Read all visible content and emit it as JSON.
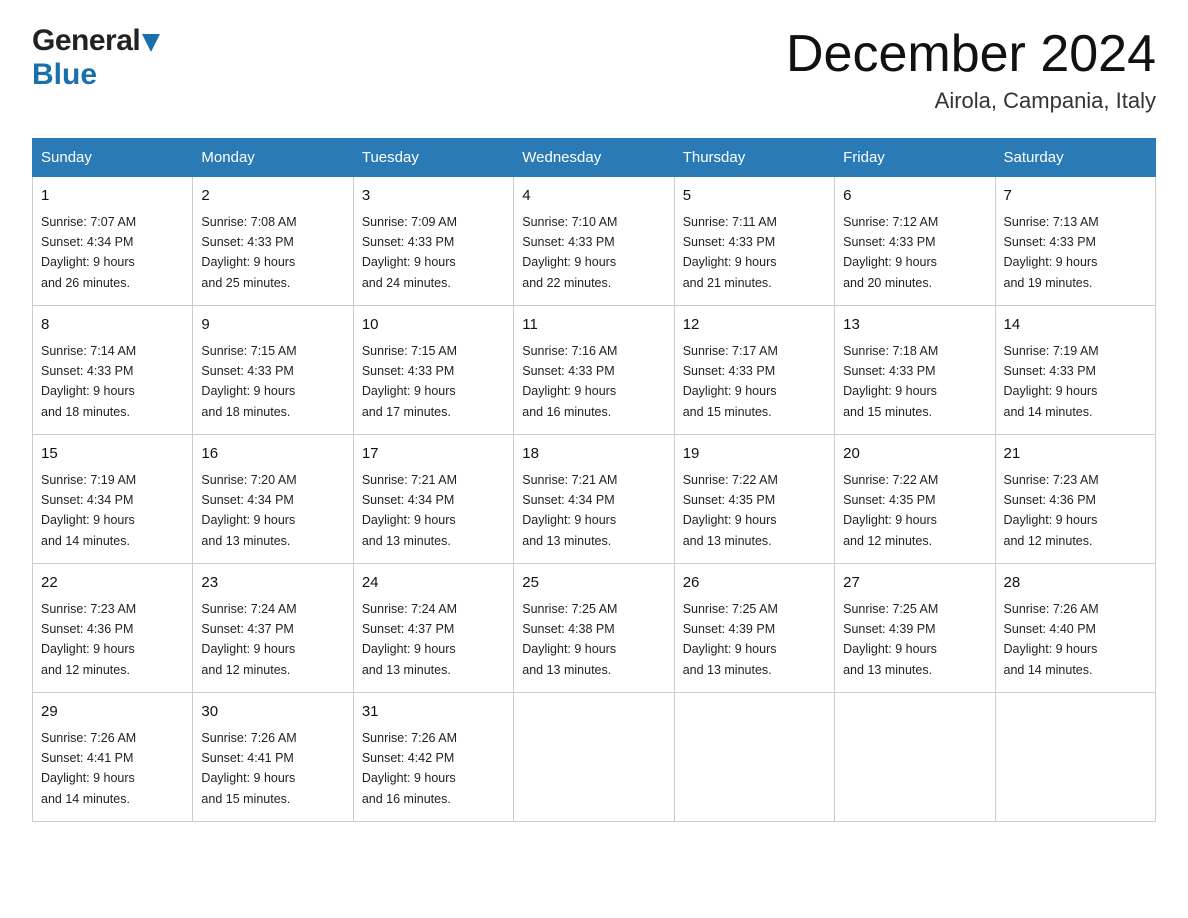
{
  "header": {
    "logo_general": "General",
    "logo_blue": "Blue",
    "month_year": "December 2024",
    "location": "Airola, Campania, Italy"
  },
  "days_of_week": [
    "Sunday",
    "Monday",
    "Tuesday",
    "Wednesday",
    "Thursday",
    "Friday",
    "Saturday"
  ],
  "weeks": [
    [
      {
        "day": "1",
        "sunrise": "7:07 AM",
        "sunset": "4:34 PM",
        "daylight": "9 hours and 26 minutes."
      },
      {
        "day": "2",
        "sunrise": "7:08 AM",
        "sunset": "4:33 PM",
        "daylight": "9 hours and 25 minutes."
      },
      {
        "day": "3",
        "sunrise": "7:09 AM",
        "sunset": "4:33 PM",
        "daylight": "9 hours and 24 minutes."
      },
      {
        "day": "4",
        "sunrise": "7:10 AM",
        "sunset": "4:33 PM",
        "daylight": "9 hours and 22 minutes."
      },
      {
        "day": "5",
        "sunrise": "7:11 AM",
        "sunset": "4:33 PM",
        "daylight": "9 hours and 21 minutes."
      },
      {
        "day": "6",
        "sunrise": "7:12 AM",
        "sunset": "4:33 PM",
        "daylight": "9 hours and 20 minutes."
      },
      {
        "day": "7",
        "sunrise": "7:13 AM",
        "sunset": "4:33 PM",
        "daylight": "9 hours and 19 minutes."
      }
    ],
    [
      {
        "day": "8",
        "sunrise": "7:14 AM",
        "sunset": "4:33 PM",
        "daylight": "9 hours and 18 minutes."
      },
      {
        "day": "9",
        "sunrise": "7:15 AM",
        "sunset": "4:33 PM",
        "daylight": "9 hours and 18 minutes."
      },
      {
        "day": "10",
        "sunrise": "7:15 AM",
        "sunset": "4:33 PM",
        "daylight": "9 hours and 17 minutes."
      },
      {
        "day": "11",
        "sunrise": "7:16 AM",
        "sunset": "4:33 PM",
        "daylight": "9 hours and 16 minutes."
      },
      {
        "day": "12",
        "sunrise": "7:17 AM",
        "sunset": "4:33 PM",
        "daylight": "9 hours and 15 minutes."
      },
      {
        "day": "13",
        "sunrise": "7:18 AM",
        "sunset": "4:33 PM",
        "daylight": "9 hours and 15 minutes."
      },
      {
        "day": "14",
        "sunrise": "7:19 AM",
        "sunset": "4:33 PM",
        "daylight": "9 hours and 14 minutes."
      }
    ],
    [
      {
        "day": "15",
        "sunrise": "7:19 AM",
        "sunset": "4:34 PM",
        "daylight": "9 hours and 14 minutes."
      },
      {
        "day": "16",
        "sunrise": "7:20 AM",
        "sunset": "4:34 PM",
        "daylight": "9 hours and 13 minutes."
      },
      {
        "day": "17",
        "sunrise": "7:21 AM",
        "sunset": "4:34 PM",
        "daylight": "9 hours and 13 minutes."
      },
      {
        "day": "18",
        "sunrise": "7:21 AM",
        "sunset": "4:34 PM",
        "daylight": "9 hours and 13 minutes."
      },
      {
        "day": "19",
        "sunrise": "7:22 AM",
        "sunset": "4:35 PM",
        "daylight": "9 hours and 13 minutes."
      },
      {
        "day": "20",
        "sunrise": "7:22 AM",
        "sunset": "4:35 PM",
        "daylight": "9 hours and 12 minutes."
      },
      {
        "day": "21",
        "sunrise": "7:23 AM",
        "sunset": "4:36 PM",
        "daylight": "9 hours and 12 minutes."
      }
    ],
    [
      {
        "day": "22",
        "sunrise": "7:23 AM",
        "sunset": "4:36 PM",
        "daylight": "9 hours and 12 minutes."
      },
      {
        "day": "23",
        "sunrise": "7:24 AM",
        "sunset": "4:37 PM",
        "daylight": "9 hours and 12 minutes."
      },
      {
        "day": "24",
        "sunrise": "7:24 AM",
        "sunset": "4:37 PM",
        "daylight": "9 hours and 13 minutes."
      },
      {
        "day": "25",
        "sunrise": "7:25 AM",
        "sunset": "4:38 PM",
        "daylight": "9 hours and 13 minutes."
      },
      {
        "day": "26",
        "sunrise": "7:25 AM",
        "sunset": "4:39 PM",
        "daylight": "9 hours and 13 minutes."
      },
      {
        "day": "27",
        "sunrise": "7:25 AM",
        "sunset": "4:39 PM",
        "daylight": "9 hours and 13 minutes."
      },
      {
        "day": "28",
        "sunrise": "7:26 AM",
        "sunset": "4:40 PM",
        "daylight": "9 hours and 14 minutes."
      }
    ],
    [
      {
        "day": "29",
        "sunrise": "7:26 AM",
        "sunset": "4:41 PM",
        "daylight": "9 hours and 14 minutes."
      },
      {
        "day": "30",
        "sunrise": "7:26 AM",
        "sunset": "4:41 PM",
        "daylight": "9 hours and 15 minutes."
      },
      {
        "day": "31",
        "sunrise": "7:26 AM",
        "sunset": "4:42 PM",
        "daylight": "9 hours and 16 minutes."
      },
      null,
      null,
      null,
      null
    ]
  ],
  "labels": {
    "sunrise": "Sunrise: ",
    "sunset": "Sunset: ",
    "daylight": "Daylight: "
  }
}
